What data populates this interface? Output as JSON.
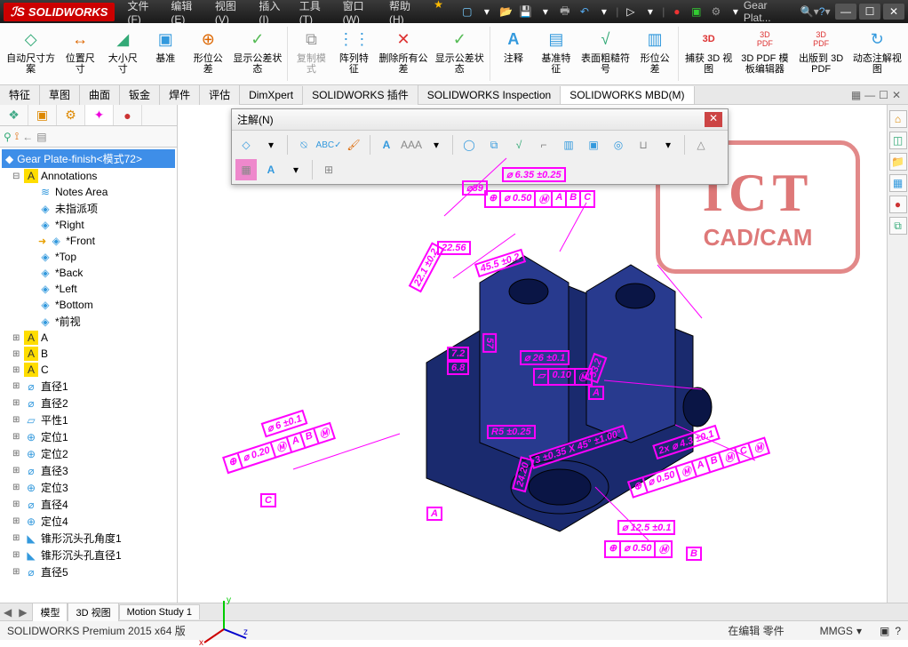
{
  "app_logo": "SOLIDWORKS",
  "menu": {
    "file": "文件(F)",
    "edit": "编辑(E)",
    "view": "视图(V)",
    "insert": "插入(I)",
    "tools": "工具(T)",
    "window": "窗口(W)",
    "help": "帮助(H)"
  },
  "doc_title": "Gear Plat...",
  "ribbon": {
    "auto_dim": "自动尺寸方案",
    "pos_dim": "位置尺寸",
    "size_dim": "大小尺寸",
    "datum": "基准",
    "form_tol": "形位公差",
    "show_tol_state": "显示公差状态",
    "copy_mode": "复制模式",
    "pattern": "阵列特征",
    "del_all_tol": "删除所有公差",
    "show_tol_state2": "显示公差状态",
    "note": "注释",
    "datum_feat": "基准特征",
    "surf_finish": "表面粗糙符号",
    "form_tol2": "形位公差",
    "cap_3d": "捕获 3D 视图",
    "tmpl_editor": "3D PDF 模板编辑器",
    "pub_pdf": "出版到 3D PDF",
    "dyn_annot": "动态注解视图"
  },
  "tabs": {
    "feature": "特征",
    "sketch": "草图",
    "surface": "曲面",
    "sheetmetal": "钣金",
    "weldment": "焊件",
    "evaluate": "评估",
    "dimxpert": "DimXpert",
    "swplugin": "SOLIDWORKS 插件",
    "swinspect": "SOLIDWORKS Inspection",
    "swmbd": "SOLIDWORKS MBD(M)"
  },
  "annot_toolbar_title": "注解(N)",
  "tree": {
    "root": "Gear Plate-finish<模式72>",
    "annotations": "Annotations",
    "notes_area": "Notes Area",
    "unspecified": "未指派项",
    "right": "*Right",
    "front": "*Front",
    "top": "*Top",
    "back": "*Back",
    "left": "*Left",
    "bottom": "*Bottom",
    "frontview": "*前视",
    "datumA": "A",
    "datumB": "B",
    "datumC": "C",
    "dia1": "直径1",
    "dia2": "直径2",
    "flat1": "平性1",
    "pos1": "定位1",
    "pos2": "定位2",
    "dia3": "直径3",
    "pos3": "定位3",
    "dia4": "直径4",
    "pos4": "定位4",
    "csk_angle1": "锥形沉头孔角度1",
    "csk_dia1": "锥形沉头孔直径1",
    "dia5": "直径5"
  },
  "bottom_tabs": {
    "model": "模型",
    "3dview": "3D 视图",
    "motion": "Motion Study 1"
  },
  "status": {
    "version": "SOLIDWORKS Premium 2015 x64 版",
    "state": "在编辑 零件",
    "units": "MMGS"
  },
  "watermark": {
    "line1": "ICT",
    "line2": "CAD/CAM"
  },
  "dimensions": {
    "d1": "⌀89",
    "d2": "⌀ 6.35 ±0.25",
    "d3": "22.56",
    "d4": "22.1 ±0.2",
    "d5": "45.5 ±0.2",
    "d6": "⌀ 6 ±0.1",
    "d7": "7.2",
    "d8": "6.8",
    "d9": "57",
    "d10": "⌀ 26 ±0.1",
    "d11": "53.2",
    "d12": "R5 ±0.25",
    "d13": "24.20",
    "d14": "⌀ 12.5 ±0.1",
    "d15": "2x ⌀ 4.3 ±0.1",
    "d16": "3 ±0.35 X 45° ±1.00°"
  },
  "gtol": {
    "g1_sym": "⊕",
    "g1_val": "⌀ 0.50",
    "g1_m": "Ⓜ",
    "g1_a": "A",
    "g1_b": "B",
    "g1_c": "C",
    "g2_sym": "▱",
    "g2_val": "0.10",
    "g2_m": "Ⓜ",
    "g3_sym": "⊕",
    "g3_val": "⌀ 0.20",
    "g3_m": "Ⓜ",
    "g3_a": "A",
    "g3_b": "B",
    "g3_m2": "Ⓜ",
    "g4_sym": "⊕",
    "g4_val": "⌀ 0.50",
    "g4_m": "Ⓜ",
    "g4_a": "A",
    "g4_b": "B",
    "g4_m2": "Ⓜ",
    "g4_c": "C",
    "g4_m3": "Ⓜ",
    "g5_sym": "⊕",
    "g5_val": "⌀ 0.50",
    "g5_m": "Ⓜ",
    "datA": "A",
    "datB": "B",
    "datC": "C"
  },
  "icon_colors": {
    "search": "🔍",
    "star": "★",
    "pdf": "3D PDF"
  }
}
